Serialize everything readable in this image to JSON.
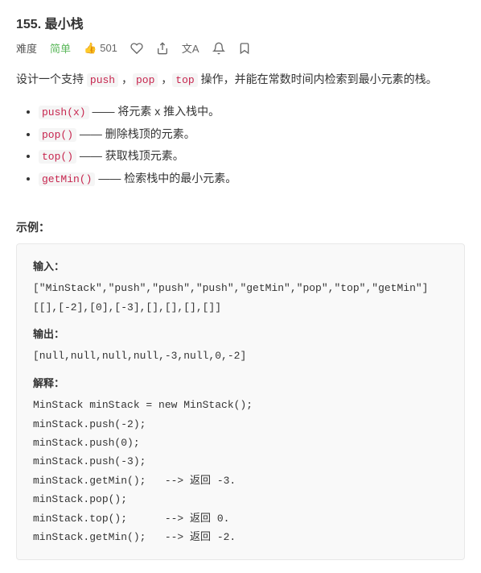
{
  "page": {
    "title": "155. 最小栈",
    "difficulty_prefix": "难度",
    "difficulty": "简单",
    "stats": {
      "likes": "501",
      "favorites": "♡",
      "share": "⎋",
      "translate": "文A",
      "bell": "🔔",
      "bookmark": "⊡"
    },
    "description": "设计一个支持 push ， pop ， top 操作，并能在常数时间内检索到最小元素的栈。",
    "operations": [
      {
        "code": "push(x)",
        "desc": "—— 将元素 x 推入栈中。"
      },
      {
        "code": "pop()",
        "desc": "—— 删除栈顶的元素。"
      },
      {
        "code": "top()",
        "desc": "—— 获取栈顶元素。"
      },
      {
        "code": "getMin()",
        "desc": "—— 检索栈中的最小元素。"
      }
    ],
    "example_label": "示例：",
    "input_label": "输入：",
    "input_line1": "[\"MinStack\",\"push\",\"push\",\"push\",\"getMin\",\"pop\",\"top\",\"getMin\"]",
    "input_line2": "[[],[-2],[0],[-3],[],[],[],[]]",
    "output_label": "输出：",
    "output_line": "[null,null,null,null,-3,null,0,-2]",
    "explain_label": "解释：",
    "explain_lines": [
      "MinStack minStack = new MinStack();",
      "minStack.push(-2);",
      "minStack.push(0);",
      "minStack.push(-3);",
      "minStack.getMin();   --> 返回 -3.",
      "minStack.pop();",
      "minStack.top();      --> 返回 0.",
      "minStack.getMin();   --> 返回 -2."
    ]
  }
}
